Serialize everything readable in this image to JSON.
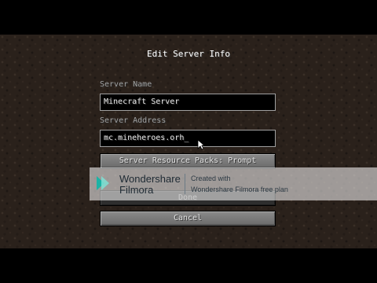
{
  "screen": {
    "title": "Edit Server Info"
  },
  "form": {
    "server_name_label": "Server Name",
    "server_name_value": "Minecraft Server",
    "server_address_label": "Server Address",
    "server_address_value": "mc.mineheroes.orh_"
  },
  "buttons": {
    "resource_packs": "Server Resource Packs: Prompt",
    "done": "Done",
    "cancel": "Cancel"
  },
  "watermark": {
    "brand_line1": "Wondershare",
    "brand_line2": "Filmora",
    "created_with": "Created with",
    "plan": "Wondershare Filmora free plan",
    "logo_color": "#1cb3a5"
  },
  "icons": {
    "logo": "filmora-logo-icon",
    "cursor": "mouse-cursor-icon"
  }
}
